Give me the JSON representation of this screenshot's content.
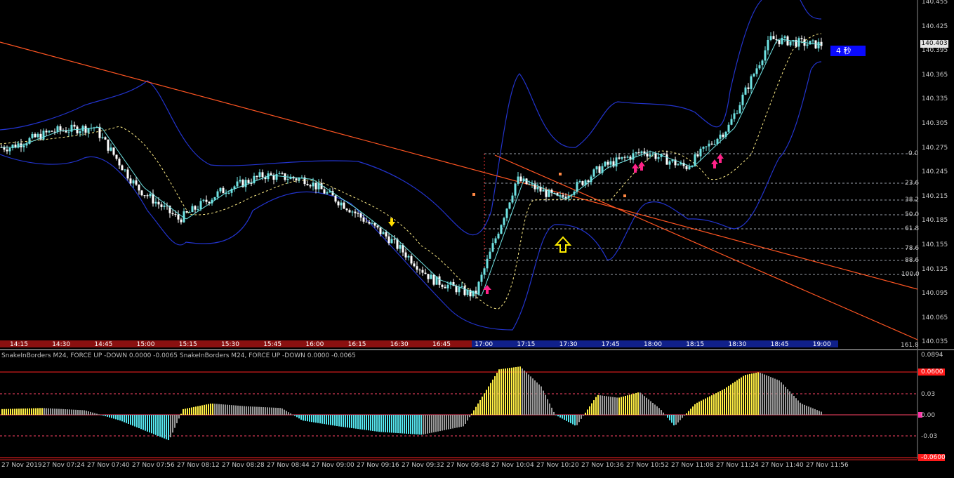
{
  "timer": {
    "text": "4 秒"
  },
  "current_price": "140.403",
  "price_axis": [
    "140.455",
    "140.425",
    "140.395",
    "140.365",
    "140.335",
    "140.305",
    "140.275",
    "140.245",
    "140.215",
    "140.185",
    "140.155",
    "140.125",
    "140.095",
    "140.065",
    "140.035"
  ],
  "fib_levels": [
    "0.0",
    "23.6",
    "38.2",
    "50.0",
    "61.8",
    "78.6",
    "88.6",
    "100.0",
    "161.8"
  ],
  "time_bar": [
    "14:15",
    "14:30",
    "14:45",
    "15:00",
    "15:15",
    "15:30",
    "15:45",
    "16:00",
    "16:15",
    "16:30",
    "16:45",
    "17:00",
    "17:15",
    "17:30",
    "17:45",
    "18:00",
    "18:15",
    "18:30",
    "18:45",
    "19:00"
  ],
  "indicator": {
    "title": "SnakeInBorders M24, FORCE UP -DOWN  0.0000 -0.0065  SnakeInBorders M24, FORCE UP -DOWN  0.0000 -0.0065",
    "axis": [
      "0.0894",
      "0.0600",
      "0.03",
      "0.00",
      "-0.03",
      "-0.0600"
    ]
  },
  "bottom_axis": [
    "27 Nov 2019",
    "27 Nov 07:24",
    "27 Nov 07:40",
    "27 Nov 07:56",
    "27 Nov 08:12",
    "27 Nov 08:28",
    "27 Nov 08:44",
    "27 Nov 09:00",
    "27 Nov 09:16",
    "27 Nov 09:32",
    "27 Nov 09:48",
    "27 Nov 10:04",
    "27 Nov 10:20",
    "27 Nov 10:36",
    "27 Nov 10:52",
    "27 Nov 11:08",
    "27 Nov 11:24",
    "27 Nov 11:40",
    "27 Nov 11:56"
  ],
  "colors": {
    "background": "#000000",
    "bull": "#6fe3e3",
    "bear": "#ffffff",
    "band": "#2233cc",
    "trend": "#ff5522",
    "hist_up": "#ffee44",
    "hist_down": "#55e6ef",
    "hist_neutral": "#9a9a9a",
    "level_line": "#ff2222"
  },
  "chart_data": {
    "type": "line",
    "title": "",
    "price_range": [
      140.035,
      140.455
    ],
    "close_path": [
      [
        "14:15",
        140.275
      ],
      [
        "14:30",
        140.295
      ],
      [
        "14:45",
        140.3
      ],
      [
        "15:00",
        140.225
      ],
      [
        "15:15",
        140.185
      ],
      [
        "15:30",
        140.22
      ],
      [
        "15:45",
        140.24
      ],
      [
        "16:00",
        140.235
      ],
      [
        "16:15",
        140.2
      ],
      [
        "16:30",
        140.16
      ],
      [
        "16:45",
        140.11
      ],
      [
        "17:00",
        140.09
      ],
      [
        "17:15",
        140.235
      ],
      [
        "17:30",
        140.21
      ],
      [
        "17:45",
        140.25
      ],
      [
        "18:00",
        140.27
      ],
      [
        "18:15",
        140.25
      ],
      [
        "18:30",
        140.3
      ],
      [
        "18:45",
        140.41
      ],
      [
        "19:00",
        140.403
      ]
    ],
    "indicator_range": [
      -0.06,
      0.0894
    ]
  }
}
